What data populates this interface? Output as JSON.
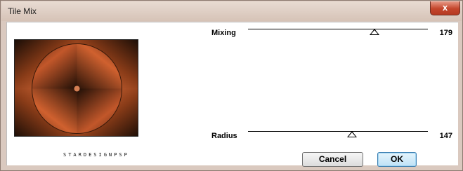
{
  "window": {
    "title": "Tile Mix",
    "close_label": "x"
  },
  "preview": {
    "colors": {
      "dark": "#1a0d06",
      "mid": "#8a3c18",
      "bright": "#f07a44"
    }
  },
  "credit": "STARDESIGNPSP",
  "params": {
    "mixing": {
      "label": "Mixing",
      "value": "179",
      "max": 255,
      "level": 179
    },
    "radius": {
      "label": "Radius",
      "value": "147",
      "max": 255,
      "level": 147
    }
  },
  "buttons": {
    "cancel": "Cancel",
    "ok": "OK"
  }
}
